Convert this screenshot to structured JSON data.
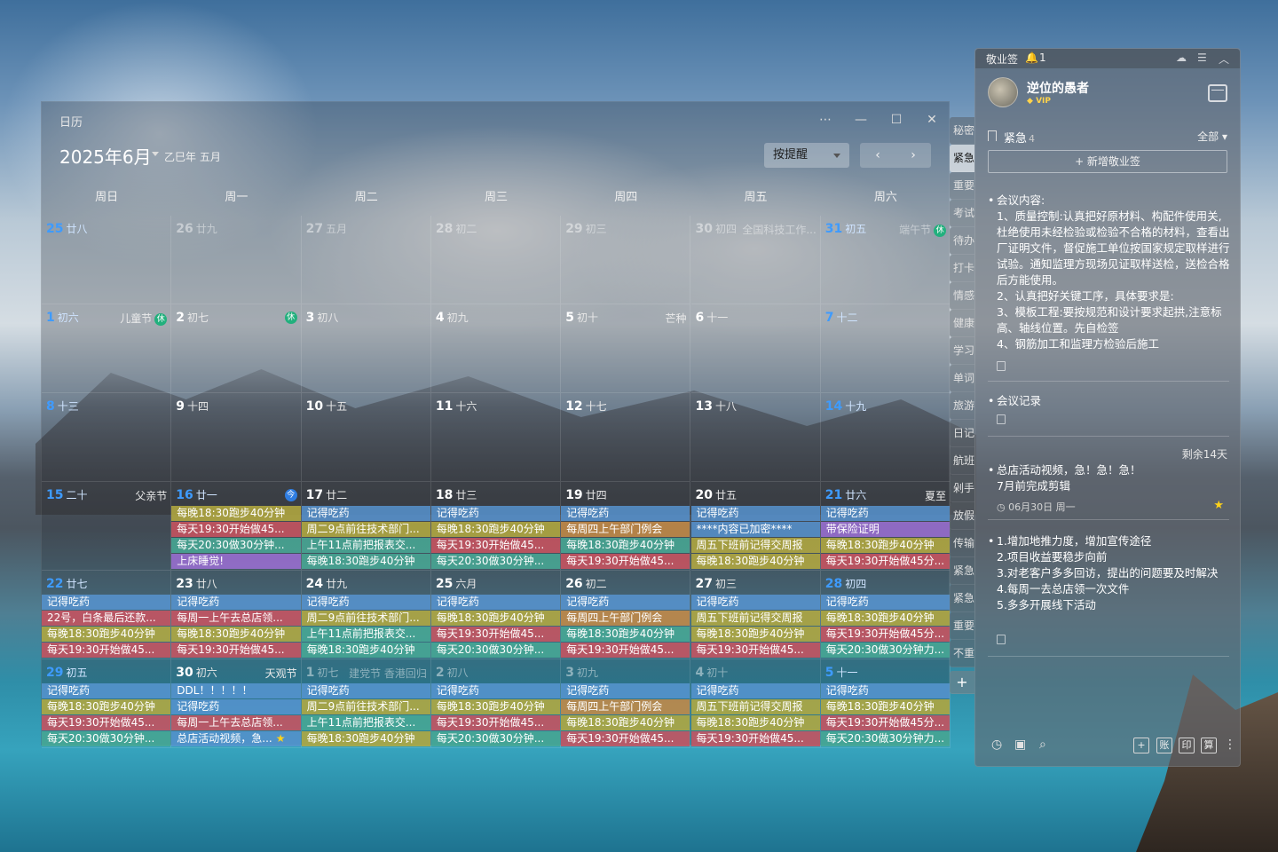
{
  "calendar": {
    "window_title": "日历",
    "month_title": "2025年6月",
    "lunar_title": "乙巳年 五月",
    "remind_select": "按提醒",
    "nav_prev": "‹",
    "nav_next": "›",
    "window_controls": [
      "⋯",
      "—",
      "☐",
      "✕"
    ],
    "weekdays": [
      "周日",
      "周一",
      "周二",
      "周三",
      "周四",
      "周五",
      "周六"
    ],
    "weeks": [
      [
        {
          "d": "25",
          "lu": "廿八",
          "dim": true,
          "blue": true
        },
        {
          "d": "26",
          "lu": "廿九",
          "dim": true
        },
        {
          "d": "27",
          "lu": "五月",
          "dim": true
        },
        {
          "d": "28",
          "lu": "初二",
          "dim": true
        },
        {
          "d": "29",
          "lu": "初三",
          "dim": true
        },
        {
          "d": "30",
          "lu": "初四",
          "dim": true,
          "fest": "全国科技工作..."
        },
        {
          "d": "31",
          "lu": "初五",
          "dim": true,
          "blue": true,
          "fest": "端午节",
          "badge": "休"
        }
      ],
      [
        {
          "d": "1",
          "lu": "初六",
          "blue": true,
          "fest": "儿童节",
          "badge": "休"
        },
        {
          "d": "2",
          "lu": "初七",
          "badge": "休"
        },
        {
          "d": "3",
          "lu": "初八"
        },
        {
          "d": "4",
          "lu": "初九"
        },
        {
          "d": "5",
          "lu": "初十",
          "fest": "芒种"
        },
        {
          "d": "6",
          "lu": "十一"
        },
        {
          "d": "7",
          "lu": "十二",
          "blue": true
        }
      ],
      [
        {
          "d": "8",
          "lu": "十三",
          "blue": true
        },
        {
          "d": "9",
          "lu": "十四"
        },
        {
          "d": "10",
          "lu": "十五"
        },
        {
          "d": "11",
          "lu": "十六"
        },
        {
          "d": "12",
          "lu": "十七"
        },
        {
          "d": "13",
          "lu": "十八"
        },
        {
          "d": "14",
          "lu": "十九",
          "blue": true
        }
      ],
      [
        {
          "d": "15",
          "lu": "二十",
          "blue": true,
          "fest": "父亲节"
        },
        {
          "d": "16",
          "lu": "廿一",
          "blue": true,
          "badge": "今",
          "today": true,
          "ev": [
            [
              "c-yellow",
              "每晚18:30跑步40分钟"
            ],
            [
              "c-red",
              "每天19:30开始做45..."
            ],
            [
              "c-teal",
              "每天20:30做30分钟..."
            ],
            [
              "c-purple",
              "上床睡觉!"
            ]
          ]
        },
        {
          "d": "17",
          "lu": "廿二",
          "ev": [
            [
              "c-blue",
              "记得吃药"
            ],
            [
              "c-yellow",
              "周二9点前往技术部门..."
            ],
            [
              "c-teal",
              "上午11点前把报表交..."
            ],
            [
              "c-teal",
              "每晚18:30跑步40分钟"
            ]
          ]
        },
        {
          "d": "18",
          "lu": "廿三",
          "ev": [
            [
              "c-blue",
              "记得吃药"
            ],
            [
              "c-yellow",
              "每晚18:30跑步40分钟"
            ],
            [
              "c-red",
              "每天19:30开始做45..."
            ],
            [
              "c-teal",
              "每天20:30做30分钟..."
            ]
          ]
        },
        {
          "d": "19",
          "lu": "廿四",
          "ev": [
            [
              "c-blue",
              "记得吃药"
            ],
            [
              "c-orange",
              "每周四上午部门例会"
            ],
            [
              "c-teal",
              "每晚18:30跑步40分钟"
            ],
            [
              "c-red",
              "每天19:30开始做45..."
            ]
          ]
        },
        {
          "d": "20",
          "lu": "廿五",
          "ev": [
            [
              "c-blue",
              "记得吃药"
            ],
            [
              "c-blue",
              "****内容已加密****"
            ],
            [
              "c-yellow",
              "周五下班前记得交周报"
            ],
            [
              "c-yellow",
              "每晚18:30跑步40分钟"
            ]
          ]
        },
        {
          "d": "21",
          "lu": "廿六",
          "blue": true,
          "fest": "夏至",
          "ev": [
            [
              "c-blue",
              "记得吃药"
            ],
            [
              "c-purple",
              "带保险证明"
            ],
            [
              "c-yellow",
              "每晚18:30跑步40分钟"
            ],
            [
              "c-red",
              "每天19:30开始做45分..."
            ]
          ]
        }
      ],
      [
        {
          "d": "22",
          "lu": "廿七",
          "blue": true,
          "ev": [
            [
              "c-blue",
              "记得吃药"
            ],
            [
              "c-red",
              "22号，白条最后还款..."
            ],
            [
              "c-yellow",
              "每晚18:30跑步40分钟"
            ],
            [
              "c-red",
              "每天19:30开始做45..."
            ]
          ]
        },
        {
          "d": "23",
          "lu": "廿八",
          "ev": [
            [
              "c-blue",
              "记得吃药"
            ],
            [
              "c-red",
              "每周一上午去总店领..."
            ],
            [
              "c-yellow",
              "每晚18:30跑步40分钟"
            ],
            [
              "c-red",
              "每天19:30开始做45..."
            ]
          ]
        },
        {
          "d": "24",
          "lu": "廿九",
          "ev": [
            [
              "c-blue",
              "记得吃药"
            ],
            [
              "c-yellow",
              "周二9点前往技术部门..."
            ],
            [
              "c-teal",
              "上午11点前把报表交..."
            ],
            [
              "c-teal",
              "每晚18:30跑步40分钟"
            ]
          ]
        },
        {
          "d": "25",
          "lu": "六月",
          "ev": [
            [
              "c-blue",
              "记得吃药"
            ],
            [
              "c-yellow",
              "每晚18:30跑步40分钟"
            ],
            [
              "c-red",
              "每天19:30开始做45..."
            ],
            [
              "c-teal",
              "每天20:30做30分钟..."
            ]
          ]
        },
        {
          "d": "26",
          "lu": "初二",
          "ev": [
            [
              "c-blue",
              "记得吃药"
            ],
            [
              "c-orange",
              "每周四上午部门例会"
            ],
            [
              "c-teal",
              "每晚18:30跑步40分钟"
            ],
            [
              "c-red",
              "每天19:30开始做45..."
            ]
          ]
        },
        {
          "d": "27",
          "lu": "初三",
          "ev": [
            [
              "c-blue",
              "记得吃药"
            ],
            [
              "c-yellow",
              "周五下班前记得交周报"
            ],
            [
              "c-yellow",
              "每晚18:30跑步40分钟"
            ],
            [
              "c-red",
              "每天19:30开始做45..."
            ]
          ]
        },
        {
          "d": "28",
          "lu": "初四",
          "blue": true,
          "ev": [
            [
              "c-blue",
              "记得吃药"
            ],
            [
              "c-yellow",
              "每晚18:30跑步40分钟"
            ],
            [
              "c-red",
              "每天19:30开始做45分..."
            ],
            [
              "c-teal",
              "每天20:30做30分钟力..."
            ]
          ]
        }
      ],
      [
        {
          "d": "29",
          "lu": "初五",
          "blue": true,
          "ev": [
            [
              "c-blue",
              "记得吃药"
            ],
            [
              "c-yellow",
              "每晚18:30跑步40分钟"
            ],
            [
              "c-red",
              "每天19:30开始做45..."
            ],
            [
              "c-teal",
              "每天20:30做30分钟..."
            ]
          ]
        },
        {
          "d": "30",
          "lu": "初六",
          "fest": "天观节",
          "ev": [
            [
              "c-blue",
              "DDL！！！！！"
            ],
            [
              "c-blue",
              "记得吃药"
            ],
            [
              "c-red",
              "每周一上午去总店领..."
            ],
            [
              "c-blue",
              "总店活动视频，急...",
              "star"
            ]
          ]
        },
        {
          "d": "1",
          "lu": "初七",
          "dim": true,
          "fest": "建党节 香港回归",
          "ev": [
            [
              "c-blue",
              "记得吃药"
            ],
            [
              "c-yellow",
              "周二9点前往技术部门..."
            ],
            [
              "c-teal",
              "上午11点前把报表交..."
            ],
            [
              "c-yellow",
              "每晚18:30跑步40分钟"
            ]
          ]
        },
        {
          "d": "2",
          "lu": "初八",
          "dim": true,
          "ev": [
            [
              "c-blue",
              "记得吃药"
            ],
            [
              "c-yellow",
              "每晚18:30跑步40分钟"
            ],
            [
              "c-red",
              "每天19:30开始做45..."
            ],
            [
              "c-teal",
              "每天20:30做30分钟..."
            ]
          ]
        },
        {
          "d": "3",
          "lu": "初九",
          "dim": true,
          "ev": [
            [
              "c-blue",
              "记得吃药"
            ],
            [
              "c-orange",
              "每周四上午部门例会"
            ],
            [
              "c-yellow",
              "每晚18:30跑步40分钟"
            ],
            [
              "c-red",
              "每天19:30开始做45..."
            ]
          ]
        },
        {
          "d": "4",
          "lu": "初十",
          "dim": true,
          "ev": [
            [
              "c-blue",
              "记得吃药"
            ],
            [
              "c-yellow",
              "周五下班前记得交周报"
            ],
            [
              "c-yellow",
              "每晚18:30跑步40分钟"
            ],
            [
              "c-red",
              "每天19:30开始做45..."
            ]
          ]
        },
        {
          "d": "5",
          "lu": "十一",
          "dim": true,
          "blue": true,
          "ev": [
            [
              "c-blue",
              "记得吃药"
            ],
            [
              "c-yellow",
              "每晚18:30跑步40分钟"
            ],
            [
              "c-red",
              "每天19:30开始做45分..."
            ],
            [
              "c-teal",
              "每天20:30做30分钟力..."
            ]
          ]
        }
      ]
    ]
  },
  "side_tabs": [
    "秘密",
    "紧急",
    "重要",
    "考试",
    "待办",
    "打卡",
    "情感",
    "健康",
    "学习",
    "单词",
    "旅游",
    "日记",
    "航班",
    "剁手",
    "放假",
    "传输",
    "紧急",
    "紧急",
    "重要",
    "不重"
  ],
  "side_tab_add": "+",
  "note": {
    "app_name": "敬业签",
    "bell_icon": "bell-icon",
    "bell_count": "1",
    "user_name": "逆位的愚者",
    "vip_label": "VIP",
    "category": "紧急",
    "category_count": "4",
    "filter": "全部",
    "new_button": "+ 新增敬业签",
    "items": [
      "会议内容:\n1、质量控制:认真把好原材料、构配件使用关,杜绝使用未经检验或检验不合格的材料，查看出厂证明文件，督促施工单位按国家规定取样进行试验。通知监理方现场见证取样送检，送检合格后方能使用。\n2、认真把好关键工序，具体要求是:\n3、模板工程:要按规范和设计要求起拱,注意标高、轴线位置。先自检签\n4、钢筋加工和监理方检验后施工",
      "会议记录",
      "总店活动视频，急！急！急！\n7月前完成剪辑",
      "1.增加地推力度，增加宣传途径\n2.项目收益要稳步向前\n3.对老客户多多回访，提出的问题要及时解决\n4.每周一去总店领一次文件\n5.多多开展线下活动"
    ],
    "remain_label": "剩余14天",
    "meta_label": "06月30日 周一",
    "footer_boxes": [
      "+",
      "账",
      "印",
      "算"
    ]
  }
}
